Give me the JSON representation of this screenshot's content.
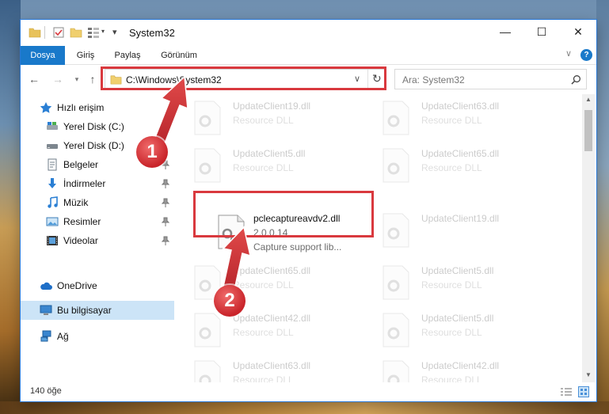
{
  "window": {
    "title": "System32"
  },
  "window_controls": {
    "minimize": "—",
    "maximize": "☐",
    "close": "✕"
  },
  "ribbon": {
    "tabs": [
      {
        "label": "Dosya",
        "active": true
      },
      {
        "label": "Giriş"
      },
      {
        "label": "Paylaş"
      },
      {
        "label": "Görünüm"
      }
    ]
  },
  "address": {
    "path": "C:\\Windows\\System32"
  },
  "search": {
    "placeholder": "Ara: System32"
  },
  "sidebar": {
    "items": [
      {
        "label": "Hızlı erişim",
        "icon": "star-icon"
      },
      {
        "label": "Yerel Disk (C:)",
        "icon": "drive-icon",
        "pinned": true
      },
      {
        "label": "Yerel Disk (D:)",
        "icon": "drive-icon",
        "pinned": true
      },
      {
        "label": "Belgeler",
        "icon": "documents-icon",
        "pinned": true
      },
      {
        "label": "İndirmeler",
        "icon": "download-icon",
        "pinned": true
      },
      {
        "label": "Müzik",
        "icon": "music-icon",
        "pinned": true
      },
      {
        "label": "Resimler",
        "icon": "pictures-icon",
        "pinned": true
      },
      {
        "label": "Videolar",
        "icon": "videos-icon",
        "pinned": true
      },
      {
        "label": "OneDrive",
        "icon": "cloud-icon"
      },
      {
        "label": "Bu bilgisayar",
        "icon": "computer-icon",
        "selected": true
      },
      {
        "label": "Ağ",
        "icon": "network-icon"
      }
    ]
  },
  "files": {
    "highlighted": {
      "name": "pclecaptureavdv2.dll",
      "version": "2.0.0.14",
      "description": "Capture support lib..."
    },
    "background": [
      {
        "name": "UpdateClient19.dll",
        "type": "Resource DLL"
      },
      {
        "name": "UpdateClient63.dll",
        "type": "Resource DLL"
      },
      {
        "name": "UpdateClient5.dll",
        "type": "Resource DLL"
      },
      {
        "name": "UpdateClient65.dll",
        "type": "Resource DLL"
      },
      {
        "name": "UpdateClient19.dll",
        "type": "Resource DLL"
      },
      {
        "name": "UpdateClient65.dll",
        "type": "Resource DLL"
      },
      {
        "name": "UpdateClient5.dll",
        "type": "Resource DLL"
      },
      {
        "name": "UpdateClient42.dll",
        "type": "Resource DLL"
      },
      {
        "name": "UpdateClient5.dll",
        "type": "Resource DLL"
      },
      {
        "name": "UpdateClient63.dll",
        "type": "Resource DLL"
      },
      {
        "name": "UpdateClient42.dll",
        "type": "Resource DLL"
      }
    ]
  },
  "status": {
    "item_count": "140 öğe"
  },
  "callouts": [
    "1",
    "2"
  ],
  "colors": {
    "accent": "#1979ca",
    "highlight_box": "#d9393e",
    "selected_bg": "#cce4f7"
  }
}
